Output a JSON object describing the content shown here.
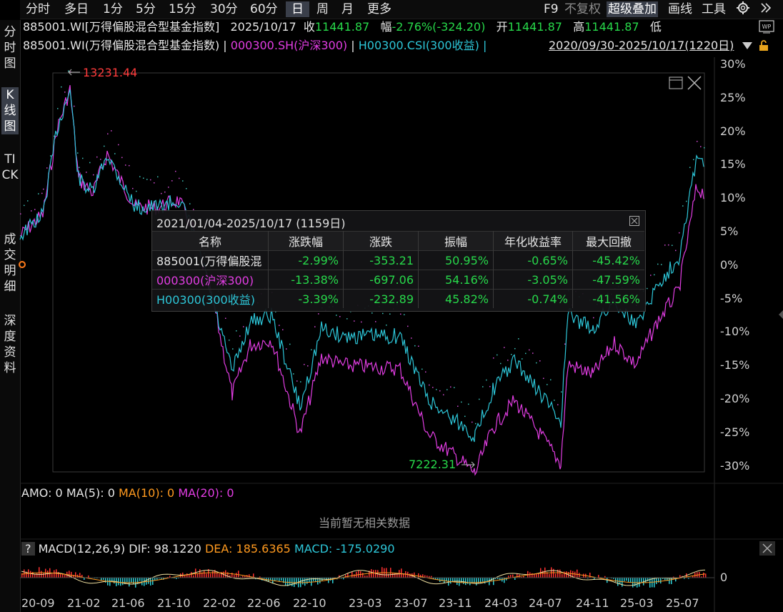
{
  "toolbar": {
    "left": [
      "分时",
      "多日",
      "1分",
      "5分",
      "15分",
      "30分",
      "60分",
      "日",
      "周",
      "月",
      "更多"
    ],
    "active": "日",
    "right": [
      "F9",
      "不复权",
      "超级叠加",
      "画线",
      "工具"
    ],
    "gear": "gear-icon",
    "expand": "double-chevron-right-icon"
  },
  "lefttabs": [
    "分时图",
    "K线图",
    "TICK",
    "成交明细",
    "深度资料"
  ],
  "info1": {
    "name": "885001.WI[万得偏股混合型基金指数]",
    "date": "2025/10/17",
    "close_label": "收",
    "close": "11441.87",
    "chg_label": "幅",
    "chg": "-2.76%(-324.20)",
    "open_label": "开",
    "open": "11441.87",
    "high_label": "高",
    "high": "11441.87",
    "low_label": "低"
  },
  "info2": {
    "s1": "885001.WI(万得偏股混合型基金指数)",
    "sep": "|",
    "s2": "000300.SH(沪深300)",
    "s3": "H00300.CSI(300收益)",
    "range": "2020/09/30-2025/10/17(1220日)"
  },
  "chart": {
    "max_label": "13231.44",
    "min_label": "7222.31",
    "yticks": [
      "30%",
      "25%",
      "20%",
      "15%",
      "10%",
      "5%",
      "0%",
      "-5%",
      "-10%",
      "-15%",
      "-20%",
      "-25%",
      "-30%"
    ],
    "xticks": [
      "20-09",
      "21-02",
      "21-06",
      "21-10",
      "22-02",
      "22-06",
      "22-10",
      "23-03",
      "23-07",
      "23-11",
      "24-03",
      "24-07",
      "24-11",
      "25-03",
      "25-07"
    ],
    "colors": {
      "s1": "#e23de3",
      "s2": "#2dc6d8",
      "s3": "#c9c9c9"
    }
  },
  "overlay": {
    "title": "2021/01/04-2025/10/17 (1159日)",
    "headers": [
      "名称",
      "涨跌幅",
      "涨跌",
      "振幅",
      "年化收益率",
      "最大回撤"
    ],
    "rows": [
      {
        "name": "885001(万得偏股混",
        "cells": [
          "-2.99%",
          "-353.21",
          "50.95%",
          "-0.65%",
          "-45.42%"
        ]
      },
      {
        "name": "000300(沪深300)",
        "cells": [
          "-13.38%",
          "-697.06",
          "54.16%",
          "-3.05%",
          "-47.59%"
        ]
      },
      {
        "name": "H00300(300收益)",
        "cells": [
          "-3.39%",
          "-232.89",
          "45.82%",
          "-0.74%",
          "-41.56%"
        ]
      }
    ]
  },
  "amo": {
    "label": "AMO: 0",
    "ma5": "MA(5): 0",
    "ma10": "MA(10): 0",
    "ma20": "MA(20): 0",
    "nodata": "当前暂无相关数据"
  },
  "macd": {
    "help": "?",
    "name": "MACD(12,26,9)",
    "dif": "DIF: 98.1220",
    "dea": "DEA: 185.6365",
    "macd": "MACD: -175.0290",
    "zero": "0"
  }
}
